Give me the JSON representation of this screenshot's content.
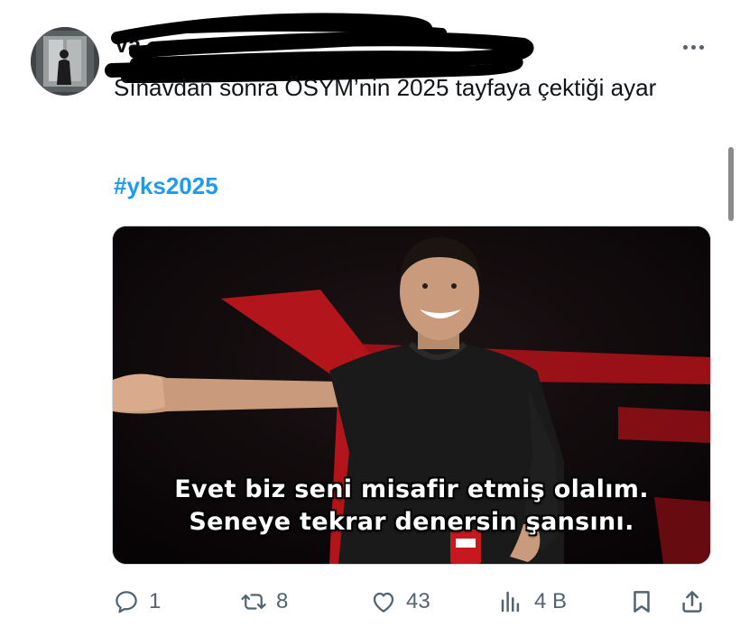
{
  "tweet": {
    "author_name": "Va",
    "text": "Sınavdan sonra ÖSYM’nin 2025 tayfaya çektiği ayar",
    "hashtag": "#yks2025"
  },
  "media": {
    "caption_line1": "Evet biz seni misafir etmiş olalım.",
    "caption_line2": "Seneye tekrar denersin şansını."
  },
  "actions": {
    "replies": "1",
    "reposts": "8",
    "likes": "43",
    "views": "4 B"
  },
  "colors": {
    "hashtag": "#1d9bf0",
    "icon": "#536471",
    "text": "#0f1419"
  },
  "icons": [
    "more-icon",
    "reply-icon",
    "repost-icon",
    "like-icon",
    "views-icon",
    "bookmark-icon",
    "share-icon"
  ]
}
